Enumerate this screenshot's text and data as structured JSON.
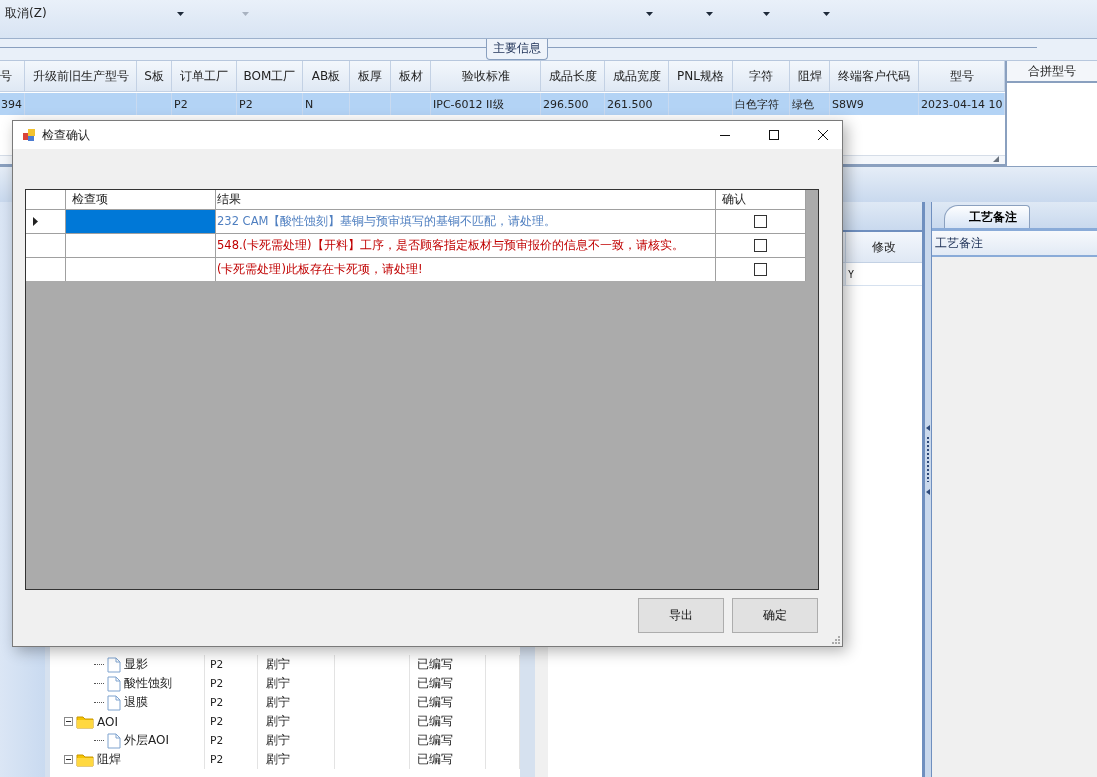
{
  "toolbar": {
    "cancel_label": "取消(Z)",
    "dropdowns": [
      {
        "disabled": false
      },
      {
        "disabled": true
      },
      {
        "disabled": false
      },
      {
        "disabled": false
      },
      {
        "disabled": false
      },
      {
        "disabled": false
      }
    ]
  },
  "main_info": {
    "title": "主要信息",
    "columns": [
      "号",
      "升级前旧生产型号",
      "S板",
      "订单工厂",
      "BOM工厂",
      "AB板",
      "板厚",
      "板材",
      "验收标准",
      "成品长度",
      "成品宽度",
      "PNL规格",
      "字符",
      "阻焊",
      "终端客户代码",
      "型号"
    ],
    "rows": [
      {
        "selected": true,
        "cells": [
          "394",
          null,
          null,
          "P2",
          "P2",
          "N",
          null,
          null,
          "IPC-6012 II级",
          "296.500",
          "261.500",
          null,
          "白色字符",
          "绿色",
          "S8W9",
          "2023-04-14 10"
        ]
      }
    ]
  },
  "merge_panel": {
    "title": "合拼型号"
  },
  "middle_grid": {
    "columns": [
      "修改"
    ],
    "rows": [
      [
        "Y"
      ]
    ]
  },
  "process_notes": {
    "tabs": [
      {
        "label": "工艺备注",
        "selected": true
      }
    ],
    "header": "工艺备注"
  },
  "tree": {
    "continued": [
      {
        "name": "显影",
        "kind": "file",
        "column_2": "P2",
        "column_3": "剧宁",
        "column_5": "已编写"
      },
      {
        "name": "酸性蚀刻",
        "kind": "file",
        "column_2": "P2",
        "column_3": "剧宁",
        "column_5": "已编写"
      },
      {
        "name": "退膜",
        "kind": "file",
        "column_2": "P2",
        "column_3": "剧宁",
        "column_5": "已编写"
      }
    ],
    "nodes": [
      {
        "name": "AOI",
        "kind": "folder",
        "expanded": true,
        "column_2": "P2",
        "column_3": "剧宁",
        "column_5": "已编写",
        "children": [
          {
            "name": "外层AOI",
            "kind": "file",
            "column_2": "P2",
            "column_3": "剧宁",
            "column_5": "已编写"
          }
        ]
      },
      {
        "name": "阻焊",
        "kind": "folder",
        "expanded": true,
        "column_2": "P2",
        "column_3": "剧宁",
        "column_5": "已编写"
      }
    ]
  },
  "dialog": {
    "title": "检查确认",
    "columns": [
      "检查项",
      "结果",
      "确认"
    ],
    "rows": [
      {
        "selected": true,
        "text": "232 CAM【酸性蚀刻】基铜与预审填写的基铜不匹配，请处理。",
        "color": "#4f7fc0",
        "checked": false
      },
      {
        "selected": false,
        "text": "548.(卡死需处理)【开料】工序，是否顾客指定板材与预审报价的信息不一致，请核实。",
        "color": "#c00000",
        "checked": false
      },
      {
        "selected": false,
        "text": "(卡死需处理)此板存在卡死项，请处理!",
        "color": "#c00000",
        "checked": false
      }
    ],
    "buttons": [
      "导出",
      "确定"
    ]
  }
}
